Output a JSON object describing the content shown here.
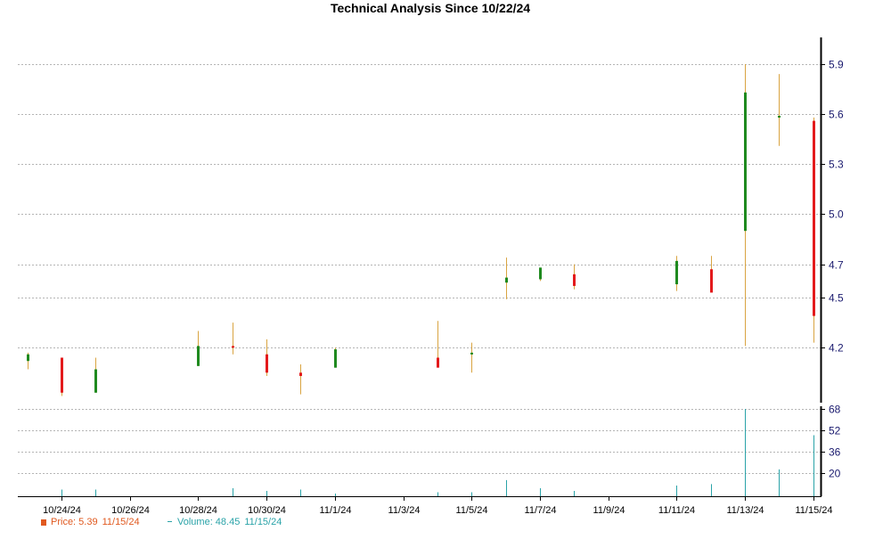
{
  "chart_data": {
    "type": "candlestick",
    "title": "Technical Analysis Since 10/22/24",
    "price_axis": {
      "ticks": [
        4.2,
        4.5,
        4.7,
        5.0,
        5.3,
        5.6,
        5.9
      ],
      "tick_labels": [
        "4.2",
        "4.5",
        "4.7",
        "5.0",
        "5.3",
        "5.6",
        "5.9"
      ],
      "range": [
        3.87,
        6.06
      ]
    },
    "volume_axis": {
      "ticks": [
        20,
        36,
        52,
        68
      ],
      "tick_labels": [
        "20",
        "36",
        "52",
        "68"
      ],
      "range": [
        3,
        70
      ]
    },
    "x_axis": {
      "tick_labels": [
        "10/24/24",
        "10/26/24",
        "10/28/24",
        "10/30/24",
        "11/1/24",
        "11/3/24",
        "11/5/24",
        "11/7/24",
        "11/9/24",
        "11/11/24",
        "11/13/24",
        "11/15/24"
      ],
      "tick_dates": [
        "2024-10-24",
        "2024-10-26",
        "2024-10-28",
        "2024-10-30",
        "2024-11-01",
        "2024-11-03",
        "2024-11-05",
        "2024-11-07",
        "2024-11-09",
        "2024-11-11",
        "2024-11-13",
        "2024-11-15"
      ]
    },
    "candles": [
      {
        "date": "2024-10-23",
        "open": 4.12,
        "high": 4.17,
        "low": 4.07,
        "close": 4.16,
        "volume": 3
      },
      {
        "date": "2024-10-24",
        "open": 4.14,
        "high": 4.14,
        "low": 3.91,
        "close": 3.93,
        "volume": 8
      },
      {
        "date": "2024-10-25",
        "open": 3.93,
        "high": 4.14,
        "low": 3.93,
        "close": 4.07,
        "volume": 8
      },
      {
        "date": "2024-10-28",
        "open": 4.09,
        "high": 4.3,
        "low": 4.09,
        "close": 4.21,
        "volume": 3
      },
      {
        "date": "2024-10-29",
        "open": 4.21,
        "high": 4.35,
        "low": 4.16,
        "close": 4.2,
        "volume": 9
      },
      {
        "date": "2024-10-30",
        "open": 4.16,
        "high": 4.25,
        "low": 4.03,
        "close": 4.05,
        "volume": 7
      },
      {
        "date": "2024-10-31",
        "open": 4.05,
        "high": 4.1,
        "low": 3.92,
        "close": 4.03,
        "volume": 8
      },
      {
        "date": "2024-11-01",
        "open": 4.08,
        "high": 4.2,
        "low": 4.08,
        "close": 4.19,
        "volume": 5
      },
      {
        "date": "2024-11-04",
        "open": 4.14,
        "high": 4.36,
        "low": 4.09,
        "close": 4.08,
        "volume": 6
      },
      {
        "date": "2024-11-05",
        "open": 4.16,
        "high": 4.23,
        "low": 4.05,
        "close": 4.17,
        "volume": 6
      },
      {
        "date": "2024-11-06",
        "open": 4.59,
        "high": 4.74,
        "low": 4.49,
        "close": 4.62,
        "volume": 15
      },
      {
        "date": "2024-11-07",
        "open": 4.61,
        "high": 4.68,
        "low": 4.6,
        "close": 4.68,
        "volume": 9
      },
      {
        "date": "2024-11-08",
        "open": 4.64,
        "high": 4.7,
        "low": 4.55,
        "close": 4.57,
        "volume": 7
      },
      {
        "date": "2024-11-11",
        "open": 4.58,
        "high": 4.75,
        "low": 4.54,
        "close": 4.72,
        "volume": 11
      },
      {
        "date": "2024-11-12",
        "open": 4.67,
        "high": 4.75,
        "low": 4.54,
        "close": 4.53,
        "volume": 12
      },
      {
        "date": "2024-11-13",
        "open": 4.9,
        "high": 5.9,
        "low": 4.21,
        "close": 5.73,
        "volume": 68
      },
      {
        "date": "2024-11-14",
        "open": 5.58,
        "high": 5.84,
        "low": 5.41,
        "close": 5.59,
        "volume": 23
      },
      {
        "date": "2024-11-15",
        "open": 5.56,
        "high": 5.58,
        "low": 4.23,
        "close": 4.39,
        "volume": 48.45
      }
    ],
    "colors": {
      "up": "#1f8a1f",
      "down": "#e31a1c",
      "wick": "#d9a441",
      "volume": "#2aa3a8",
      "grid": "#b5b5b5",
      "axis": "#000000",
      "tick_label": "#1a1a6e",
      "x_label": "#000000"
    }
  },
  "legend": {
    "price_label": "Price: 5.39",
    "price_date": "11/15/24",
    "volume_label": "Volume: 48.45",
    "volume_date": "11/15/24"
  }
}
